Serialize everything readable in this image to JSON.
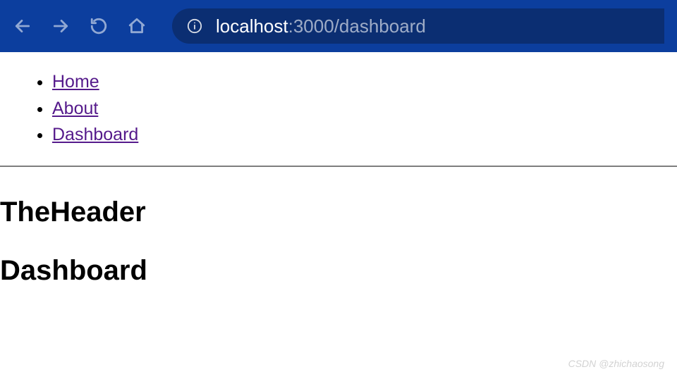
{
  "browser": {
    "url_host": "localhost",
    "url_path": ":3000/dashboard"
  },
  "nav": {
    "items": [
      {
        "label": "Home"
      },
      {
        "label": "About"
      },
      {
        "label": "Dashboard"
      }
    ]
  },
  "page": {
    "header": "TheHeader",
    "title": "Dashboard"
  },
  "watermark": "CSDN @zhichaosong"
}
